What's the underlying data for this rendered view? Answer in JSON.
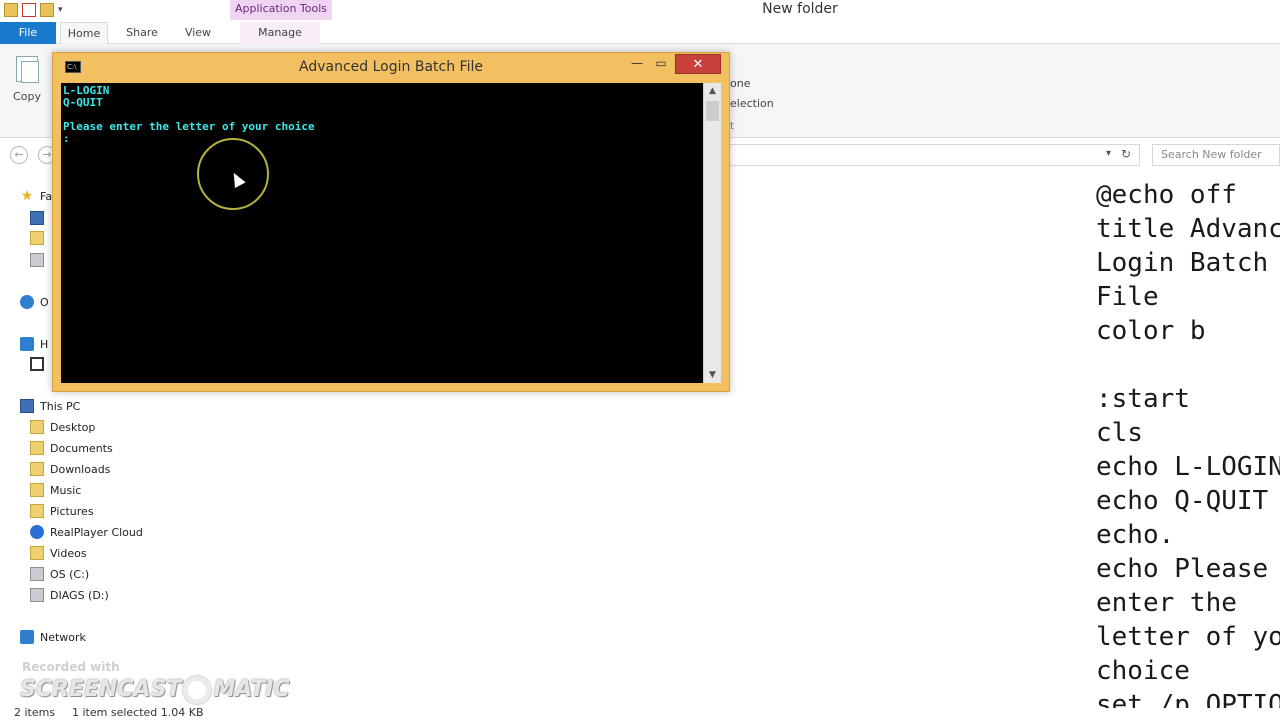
{
  "explorer": {
    "window_title": "New folder",
    "app_tools_label": "Application Tools",
    "quick_access_icons": [
      "folder-icon",
      "properties-icon",
      "new-folder-icon",
      "dropdown-icon"
    ],
    "tabs": [
      {
        "label": "File"
      },
      {
        "label": "Home"
      },
      {
        "label": "Share"
      },
      {
        "label": "View"
      },
      {
        "label": "Manage"
      }
    ],
    "ribbon": {
      "copy_label": "Copy",
      "frag_1": "one",
      "frag_2": "election",
      "frag_3": "t"
    },
    "search_placeholder": "Search New folder",
    "nav_pane": {
      "favorites_label": "Fa",
      "onedrive_label": "O",
      "homegroup_label": "H",
      "this_pc": "This PC",
      "items": [
        {
          "label": "Desktop",
          "icon": "folder-icon"
        },
        {
          "label": "Documents",
          "icon": "folder-icon"
        },
        {
          "label": "Downloads",
          "icon": "folder-icon"
        },
        {
          "label": "Music",
          "icon": "folder-icon"
        },
        {
          "label": "Pictures",
          "icon": "folder-icon"
        },
        {
          "label": "RealPlayer Cloud",
          "icon": "realplayer-icon"
        },
        {
          "label": "Videos",
          "icon": "folder-icon"
        },
        {
          "label": "OS (C:)",
          "icon": "drive-icon"
        },
        {
          "label": "DIAGS (D:)",
          "icon": "drive-icon"
        }
      ],
      "network": "Network"
    },
    "preview_lines": [
      "@echo off",
      "title Advanc",
      "Login Batch",
      "File",
      "color b",
      "",
      ":start",
      "cls",
      "echo L-LOGIN",
      "echo Q-QUIT",
      "echo.",
      "echo Please",
      "enter the",
      "letter of yo",
      "choice",
      "set /p OPTIO"
    ],
    "status": {
      "item_count": "2 items",
      "selection": "1 item selected  1.04 KB"
    },
    "watermark": {
      "top": "Recorded with",
      "main_left": "SCREENCAST",
      "main_right": "MATIC"
    }
  },
  "cmd": {
    "title": "Advanced Login Batch File",
    "console_color": "#3ce8e8",
    "lines": [
      "L-LOGIN",
      "Q-QUIT",
      "",
      "Please enter the letter of your choice",
      ":"
    ],
    "minimize_glyph": "—",
    "maximize_glyph": "▭",
    "close_glyph": "✕"
  }
}
